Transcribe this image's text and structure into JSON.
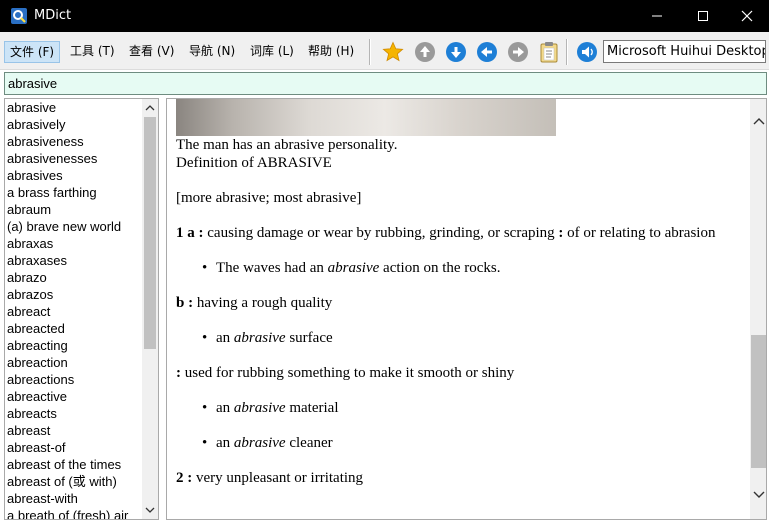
{
  "window": {
    "title": "MDict"
  },
  "menu": [
    {
      "label": "文件 (F)",
      "active": true
    },
    {
      "label": "工具 (T)"
    },
    {
      "label": "查看 (V)"
    },
    {
      "label": "导航 (N)"
    },
    {
      "label": "词库 (L)"
    },
    {
      "label": "帮助 (H)"
    }
  ],
  "toolbar": {
    "dictionary": "Microsoft Huihui Desktop - "
  },
  "search": {
    "value": "abrasive"
  },
  "word_list": [
    "abrasive",
    "abrasively",
    "abrasiveness",
    "abrasivenesses",
    "abrasives",
    "a brass farthing",
    "abraum",
    "(a) brave new world",
    "abraxas",
    "abraxases",
    "abrazo",
    "abrazos",
    "abreact",
    "abreacted",
    "abreacting",
    "abreaction",
    "abreactions",
    "abreactive",
    "abreacts",
    "abreast",
    "abreast-of",
    "abreast of the times",
    "abreast of (或 with)",
    "abreast-with",
    "a breath of (fresh) air"
  ],
  "entry": {
    "caption": "The man has an abrasive personality.",
    "heading": "Definition of ABRASIVE",
    "forms": "[more abrasive; most abrasive]",
    "sense1a_label": "1 a :",
    "sense1a_text": "causing damage or wear by rubbing, grinding, or scraping",
    "sense1a_or_label": ":",
    "sense1a_or_text": "of or relating to abrasion",
    "ex1_pre": "The waves had an ",
    "ex1_word": "abrasive",
    "ex1_post": " action on the rocks.",
    "sense1b_label": "b :",
    "sense1b_text": "having a rough quality",
    "ex2_pre": "an ",
    "ex2_word": "abrasive",
    "ex2_post": " surface",
    "sense1c_label": ":",
    "sense1c_text": "used for rubbing something to make it smooth or shiny",
    "ex3_pre": "an ",
    "ex3_word": "abrasive",
    "ex3_post": " material",
    "ex4_pre": "an ",
    "ex4_word": "abrasive",
    "ex4_post": " cleaner",
    "sense2_label": "2 :",
    "sense2_text": "very unpleasant or irritating"
  },
  "colors": {
    "titlebar": "#000000",
    "search_bg": "#e6fbf3",
    "menu_active": "#cce4f7",
    "star": "#f5b400",
    "nav_blue": "#1e7fd6",
    "nav_gray": "#9a9a9a"
  }
}
